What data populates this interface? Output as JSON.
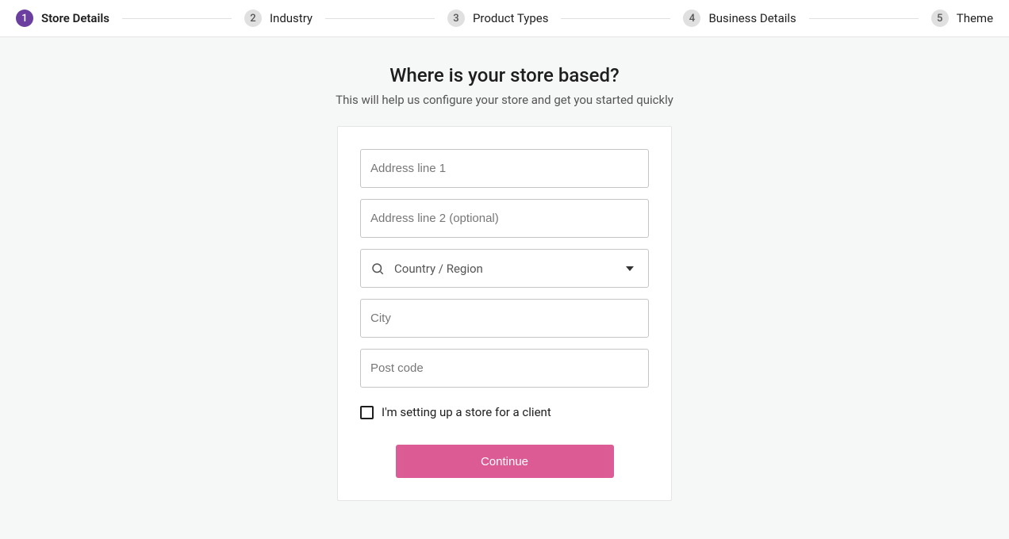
{
  "stepper": {
    "steps": [
      {
        "num": "1",
        "label": "Store Details",
        "active": true
      },
      {
        "num": "2",
        "label": "Industry",
        "active": false
      },
      {
        "num": "3",
        "label": "Product Types",
        "active": false
      },
      {
        "num": "4",
        "label": "Business Details",
        "active": false
      },
      {
        "num": "5",
        "label": "Theme",
        "active": false
      }
    ]
  },
  "main": {
    "title": "Where is your store based?",
    "subtitle": "This will help us configure your store and get you started quickly"
  },
  "form": {
    "address1_placeholder": "Address line 1",
    "address2_placeholder": "Address line 2 (optional)",
    "country_placeholder": "Country / Region",
    "city_placeholder": "City",
    "postcode_placeholder": "Post code",
    "client_checkbox_label": "I'm setting up a store for a client",
    "continue_label": "Continue"
  },
  "colors": {
    "accent_purple": "#6b3fa0",
    "accent_pink": "#d63f82",
    "bg": "#f6f7f7"
  }
}
